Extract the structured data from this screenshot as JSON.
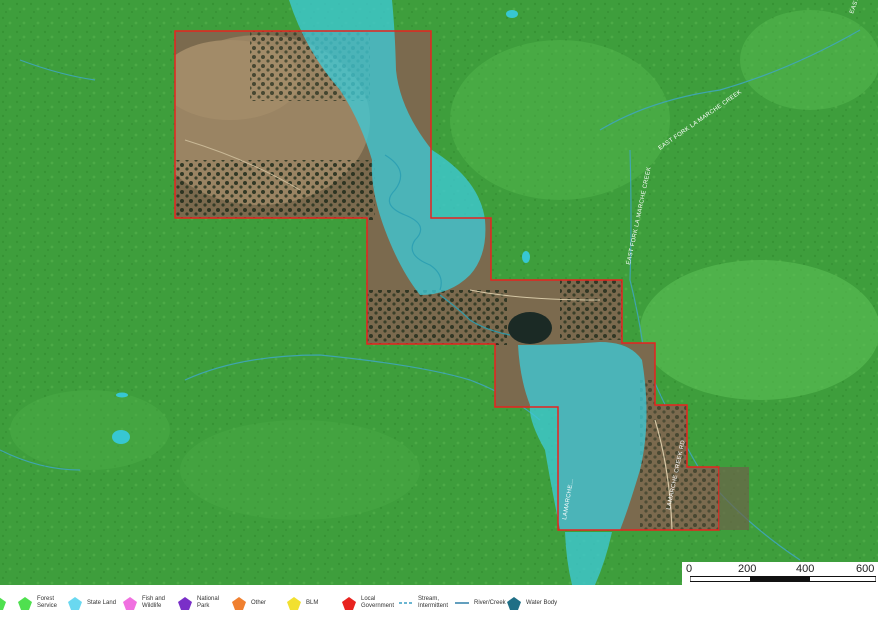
{
  "map": {
    "roads": [
      {
        "label": "EAST FORK LA MARCHE CREEK"
      },
      {
        "label": "EAST FORK LA MARCHE CREEK"
      },
      {
        "label": "EAST FO..."
      },
      {
        "label": "LAMARCHE CREEK RD"
      },
      {
        "label": "LAMARCHE..."
      }
    ],
    "colors": {
      "forest_service": "#3fa63a",
      "state_land": "#3ec9d6",
      "parcel_outline": "#e8231f"
    }
  },
  "legend": {
    "items": [
      {
        "label": "Forest\nService",
        "color": "#4fe04f",
        "icon": "pentagon-swatch"
      },
      {
        "label": "State Land",
        "color": "#6ad8f0",
        "icon": "pentagon-swatch"
      },
      {
        "label": "Fish and\nWildlife",
        "color": "#f070e0",
        "icon": "pentagon-swatch"
      },
      {
        "label": "National\nPark",
        "color": "#7a2fc8",
        "icon": "pentagon-swatch"
      },
      {
        "label": "Other",
        "color": "#f08030",
        "icon": "pentagon-swatch"
      },
      {
        "label": "BLM",
        "color": "#f2e030",
        "icon": "pentagon-swatch"
      },
      {
        "label": "Local\nGovernment",
        "color": "#e8231f",
        "icon": "pentagon-swatch"
      },
      {
        "label": "Stream,\nIntermittent",
        "color": "#3a9ec4",
        "icon": "dashed-line"
      },
      {
        "label": "River/Creek",
        "color": "#2f7fa8",
        "icon": "solid-line"
      },
      {
        "label": "Water Body",
        "color": "#1f6f86",
        "icon": "pentagon-swatch"
      }
    ]
  },
  "scale": {
    "ticks": [
      "0",
      "200",
      "400",
      "600"
    ]
  }
}
